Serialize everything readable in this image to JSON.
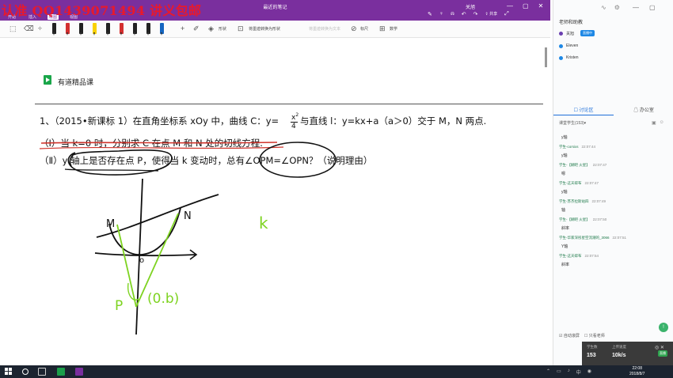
{
  "watermark": "认准 QQ1439071494 讲义包邮",
  "titlebar": {
    "doc_title": "最近的笔记",
    "user": "关旭",
    "tabs": [
      "开始",
      "插入",
      "绘图",
      "视图"
    ],
    "share_label": "共享",
    "window_controls": [
      "—",
      "▢",
      "✕"
    ]
  },
  "toolbar": {
    "shape_label": "形状",
    "ink_to_shape_label": "将墨迹转换为形状",
    "ink_to_text_label": "将墨迹转换为文本",
    "ruler_label": "标尺",
    "math_label": "数学",
    "pen_colors": [
      "#222222",
      "#d32f2f",
      "#222222",
      "#f9d100",
      "#222222",
      "#d32f2f",
      "#222222",
      "#222222",
      "#1565c0"
    ]
  },
  "note": {
    "brand": "有道精品课",
    "q_line1_a": "1、（2015•新课标 1）在直角坐标系 xOy 中，曲线 C：y=",
    "frac_num": "x",
    "frac_sup": "2",
    "frac_den": "4",
    "q_line1_b": "与直线 l：y=kx+a（a＞0）交于 M，N 两点.",
    "q_line2": "（Ⅰ）当 k=0 时，分别求 C 在点 M 和 N 处的切线方程.",
    "q_line3": "（Ⅱ）y 轴上是否存在点 P，使得当 k 变动时，总有∠OPM=∠OPN？（说明理由）",
    "hw_M": "M",
    "hw_N": "N",
    "hw_o": "o",
    "hw_P": "P",
    "hw_point": "(0.b)",
    "hw_k": "k"
  },
  "sidebar": {
    "section_title": "老师和助教",
    "members": [
      {
        "name": "关旭",
        "badge": "直播中"
      },
      {
        "name": "Eleven",
        "badge": ""
      },
      {
        "name": "Kristen",
        "badge": ""
      }
    ],
    "tabs": [
      "讨论区",
      "办公室"
    ],
    "filter": "课堂学生(153)▾",
    "messages": [
      {
        "user": "",
        "time": "",
        "text": "y轴"
      },
      {
        "user": "学生-corsixs",
        "time": "22:07:44",
        "text": "y轴"
      },
      {
        "user": "学生-【糊吧 火星】",
        "time": "22:07:47",
        "text": "嗯"
      },
      {
        "user": "学生-这天碎布",
        "time": "22:07:47",
        "text": "y轴"
      },
      {
        "user": "学生-苏杰拉斯站四",
        "time": "22:07:49",
        "text": "轴"
      },
      {
        "user": "学生-【糊吧 火星】",
        "time": "22:07:50",
        "text": "斜率"
      },
      {
        "user": "学生-华家深彤星空流潮的_3066",
        "time": "22:07:51",
        "text": "Y轴"
      },
      {
        "user": "学生-这天碎布",
        "time": "22:07:54",
        "text": "斜率"
      }
    ],
    "auto_scroll": "自动滚屏",
    "only_teacher": "只看老师"
  },
  "stats": {
    "students_label": "学生数",
    "students": "153",
    "bitrate_label": "上传速度",
    "bitrate": "10k/s",
    "live": "直播"
  },
  "taskbar": {
    "time": "22:08",
    "date": "2018/8/7"
  }
}
